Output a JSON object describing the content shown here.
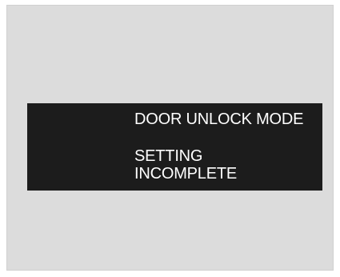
{
  "display": {
    "title": "DOOR UNLOCK MODE",
    "status_line1": "SETTING",
    "status_line2": "INCOMPLETE"
  },
  "colors": {
    "background": "#dcdcdc",
    "display_background": "#1c1c1c",
    "text": "#ffffff"
  }
}
